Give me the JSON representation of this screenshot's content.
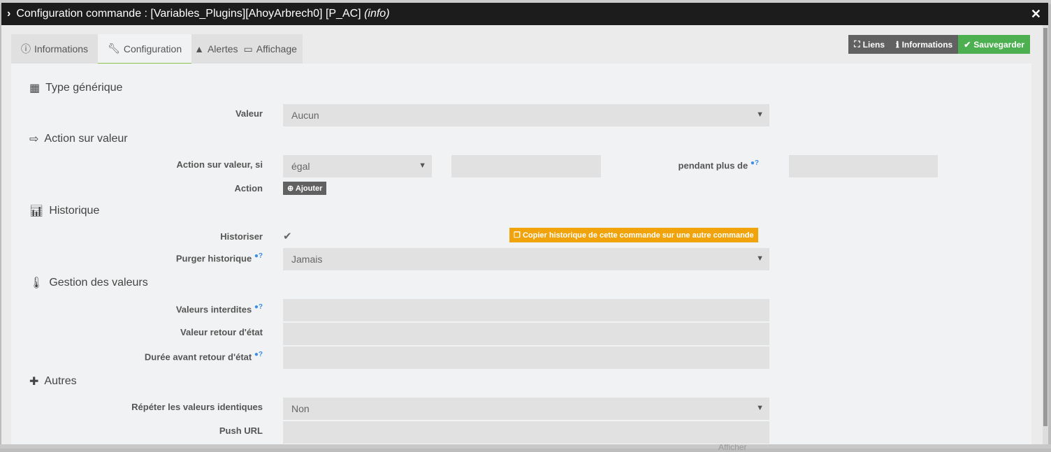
{
  "title": {
    "main": "Configuration commande : [Variables_Plugins][AhoyArbrech0] [P_AC]",
    "type": "(info)"
  },
  "tabs": [
    "Informations",
    "Configuration",
    "Alertes",
    "Affichage"
  ],
  "actions": {
    "liens": "Liens",
    "informations": "Informations",
    "save": "Sauvegarder"
  },
  "sections": {
    "type": "Type générique",
    "action": "Action sur valeur",
    "historique": "Historique",
    "gestion": "Gestion des valeurs",
    "autres": "Autres"
  },
  "fields": {
    "valeur_label": "Valeur",
    "valeur": "Aucun",
    "action_si_label": "Action sur valeur, si",
    "action_si": "égal",
    "pendant_label": "pendant plus de",
    "action_label": "Action",
    "ajouter": "Ajouter",
    "historiser_label": "Historiser",
    "copy": "Copier historique de cette commande sur une autre commande",
    "purger_label": "Purger historique",
    "purger": "Jamais",
    "interdites_label": "Valeurs interdites",
    "retour_label": "Valeur retour d'état",
    "duree_label": "Durée avant retour d'état",
    "repeter_label": "Répéter les valeurs identiques",
    "repeter": "Non",
    "push_label": "Push URL"
  },
  "background": {
    "afficher": "Afficher"
  }
}
